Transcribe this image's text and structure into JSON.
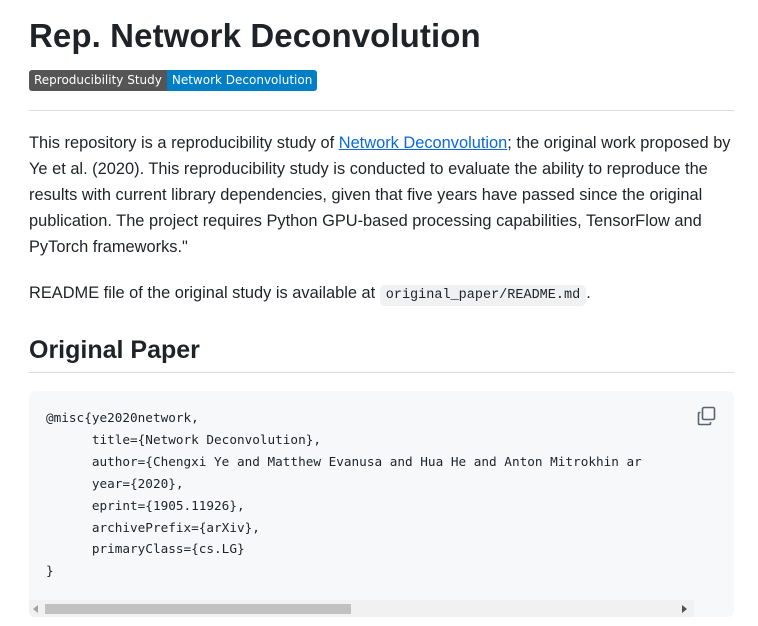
{
  "header": {
    "title": "Rep. Network Deconvolution",
    "badge_left": "Reproducibility Study",
    "badge_right": "Network Deconvolution",
    "badge_left_color": "#555555",
    "badge_right_color": "#007ec6"
  },
  "intro": {
    "text_before_link": "This repository is a reproducibility study of ",
    "link_text": "Network Deconvolution",
    "text_after_link": "; the original work proposed by Ye et al. (2020). This reproducibility study is conducted to evaluate the ability to reproduce the results with current library dependencies, given that five years have passed since the original publication. The project requires Python GPU-based processing capabilities, TensorFlow and PyTorch frameworks.\""
  },
  "readme_line": {
    "text": "README file of the original study is available at ",
    "code": "original_paper/README.md",
    "suffix": "."
  },
  "section": {
    "heading": "Original Paper"
  },
  "bibtex": {
    "lines": [
      "@misc{ye2020network,",
      "      title={Network Deconvolution},",
      "      author={Chengxi Ye and Matthew Evanusa and Hua He and Anton Mitrokhin ar",
      "      year={2020},",
      "      eprint={1905.11926},",
      "      archivePrefix={arXiv},",
      "      primaryClass={cs.LG}",
      "}"
    ],
    "copy_icon": "copy-icon"
  },
  "colors": {
    "link": "#0969da",
    "text": "#1f2328",
    "code_bg": "#f6f8fa"
  }
}
